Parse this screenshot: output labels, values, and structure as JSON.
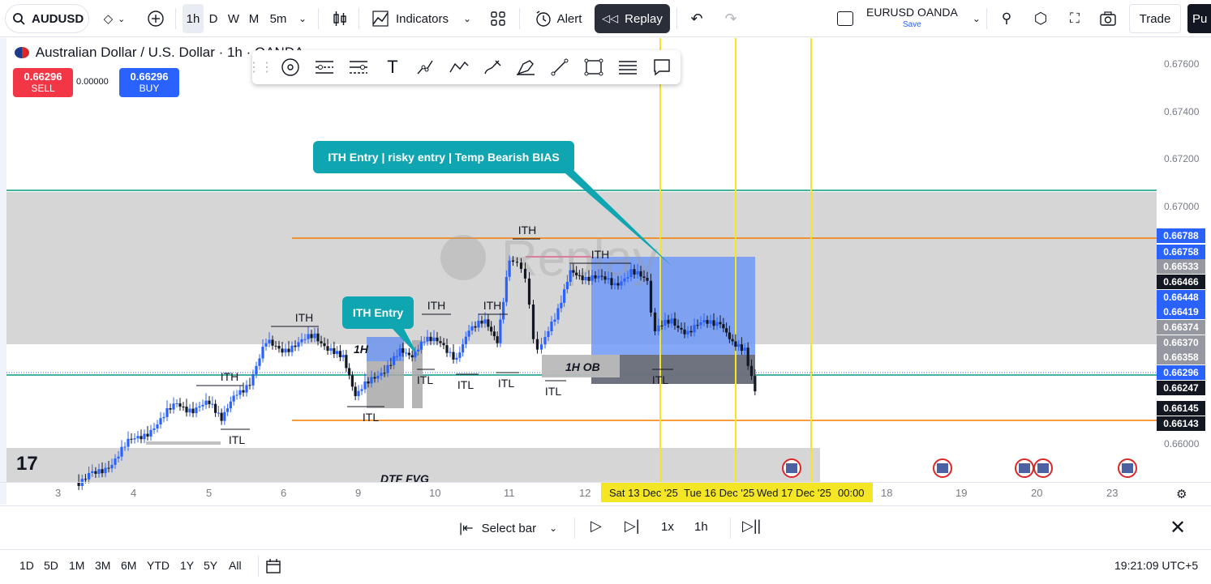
{
  "topbar": {
    "symbol": "AUDUSD",
    "intervals": [
      "1h",
      "D",
      "W",
      "M",
      "5m"
    ],
    "indicators_label": "Indicators",
    "alert_label": "Alert",
    "replay_label": "Replay",
    "layout_name": "EURUSD OANDA",
    "layout_save": "Save",
    "trade_label": "Trade",
    "publish_label": "Pu"
  },
  "legend": {
    "title": "Australian Dollar / U.S. Dollar · 1h · OANDA",
    "sell_price": "0.66296",
    "sell_label": "SELL",
    "spread": "0.00000",
    "buy_price": "0.66296",
    "buy_label": "BUY"
  },
  "price_axis": {
    "labels": [
      "0.67600",
      "0.67400",
      "0.67200",
      "0.67000",
      "0.66000"
    ],
    "tags": [
      {
        "value": "0.66788",
        "color": "#2962ff"
      },
      {
        "value": "0.66758",
        "color": "#2962ff"
      },
      {
        "value": "0.66533",
        "color": "#9598a1"
      },
      {
        "value": "0.66466",
        "color": "#131722"
      },
      {
        "value": "0.66448",
        "color": "#2962ff"
      },
      {
        "value": "0.66419",
        "color": "#2962ff"
      },
      {
        "value": "0.66374",
        "color": "#9598a1"
      },
      {
        "value": "0.66370",
        "color": "#9598a1"
      },
      {
        "value": "0.66358",
        "color": "#9598a1"
      },
      {
        "value": "0.66296",
        "color": "#2962ff"
      },
      {
        "value": "0.66247",
        "color": "#131722"
      },
      {
        "value": "0.66145",
        "color": "#131722"
      },
      {
        "value": "0.66143",
        "color": "#131722"
      }
    ]
  },
  "time_axis": {
    "labels": [
      "3",
      "4",
      "5",
      "6",
      "9",
      "10",
      "11",
      "12",
      "18",
      "19",
      "20",
      "23"
    ],
    "highlight": [
      "Sat 13 Dec '25",
      "Tue 16 Dec '25",
      "Wed 17 Dec '25",
      "00:00"
    ]
  },
  "annotations": {
    "callout_main": "ITH Entry | risky entry | Temp Bearish BIAS",
    "callout_small": "ITH Entry",
    "ith": "ITH",
    "itl": "ITL",
    "ob_1h": "1H OB",
    "h1": "1H",
    "dtf_fvg": "DTF FVG",
    "watermark": "Replay"
  },
  "replay_controls": {
    "select_bar": "Select bar",
    "speed": "1x",
    "interval": "1h"
  },
  "bottom": {
    "ranges": [
      "1D",
      "5D",
      "1M",
      "3M",
      "6M",
      "YTD",
      "1Y",
      "5Y",
      "All"
    ],
    "clock": "19:21:09 UTC+5"
  },
  "colors": {
    "up": "#2962ff",
    "down": "#131722",
    "orange": "#f57c00",
    "green": "#089981",
    "yellow": "#f5e625",
    "callout": "#10a6b1"
  }
}
